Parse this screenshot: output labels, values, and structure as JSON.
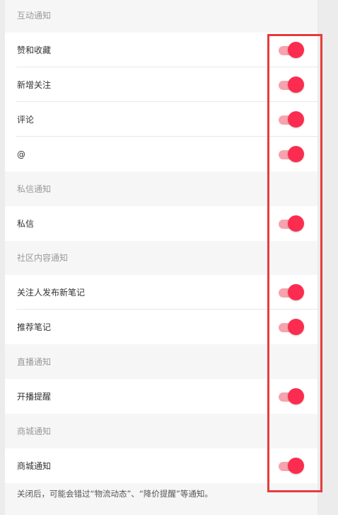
{
  "sections": {
    "interaction": {
      "title": "互动通知",
      "likes_label": "赞和收藏",
      "follows_label": "新增关注",
      "comments_label": "评论",
      "mentions_label": "@"
    },
    "private_message": {
      "title": "私信通知",
      "dm_label": "私信"
    },
    "community": {
      "title": "社区内容通知",
      "followed_posts_label": "关注人发布新笔记",
      "recommended_label": "推荐笔记"
    },
    "live": {
      "title": "直播通知",
      "live_start_label": "开播提醒"
    },
    "mall": {
      "title": "商城通知",
      "mall_label": "商城通知"
    }
  },
  "toggles": {
    "likes": true,
    "follows": true,
    "comments": true,
    "mentions": true,
    "dm": true,
    "followed_posts": true,
    "recommended": true,
    "live_start": true,
    "mall": true
  },
  "footer_note": "关闭后，可能会错过“物流动态”、“降价提醒”等通知。",
  "colors": {
    "accent": "#fb2c4f",
    "track": "#f6a3ad",
    "annotation": "#e63c3c"
  }
}
